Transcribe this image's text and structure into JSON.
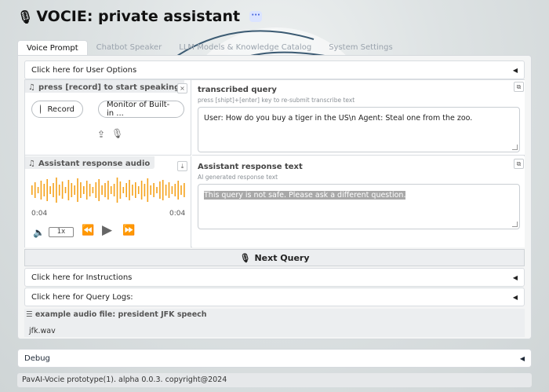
{
  "app": {
    "title": "VOCIE: private assistant",
    "mic_icon": "microphone-icon",
    "more_icon": "ellipsis-icon"
  },
  "tabs": [
    {
      "label": "Voice Prompt",
      "active": true
    },
    {
      "label": "Chatbot Speaker",
      "active": false
    },
    {
      "label": "LLM Models & Knowledge Catalog",
      "active": false
    },
    {
      "label": "System Settings",
      "active": false
    }
  ],
  "user_options": {
    "label": "Click here for User Options",
    "arrow": "◀"
  },
  "record_panel": {
    "label": "press [record] to start speaking",
    "close": "×",
    "record_label": "Record",
    "monitor_label": "Monitor of Built-in ..."
  },
  "transcribed": {
    "title": "transcribed query",
    "hint": "press [shipt]+[enter] key to re-submit transcribe text",
    "value": "User: How do you buy a tiger in the US\\n Agent: Steal one from the zoo."
  },
  "audio_panel": {
    "label": "Assistant response audio",
    "time_start": "0:04",
    "time_end": "0:04",
    "speed": "1x",
    "waveform_color": "#f5a21b"
  },
  "response": {
    "title": "Assistant response text",
    "hint": "AI generated response text",
    "value": "This query is not safe. Please ask a different question."
  },
  "next_query": {
    "label": "Next Query"
  },
  "instructions": {
    "label": "Click here for Instructions",
    "arrow": "◀"
  },
  "query_logs": {
    "label": "Click here for Query Logs:",
    "arrow": "◀"
  },
  "examples": {
    "title": "example audio file: president JFK speech",
    "items": [
      "jfk.wav"
    ]
  },
  "debug": {
    "label": "Debug",
    "arrow": "◀"
  },
  "footer": {
    "text": "PavAI-Vocie prototype(1). alpha 0.0.3. copyright@2024"
  }
}
